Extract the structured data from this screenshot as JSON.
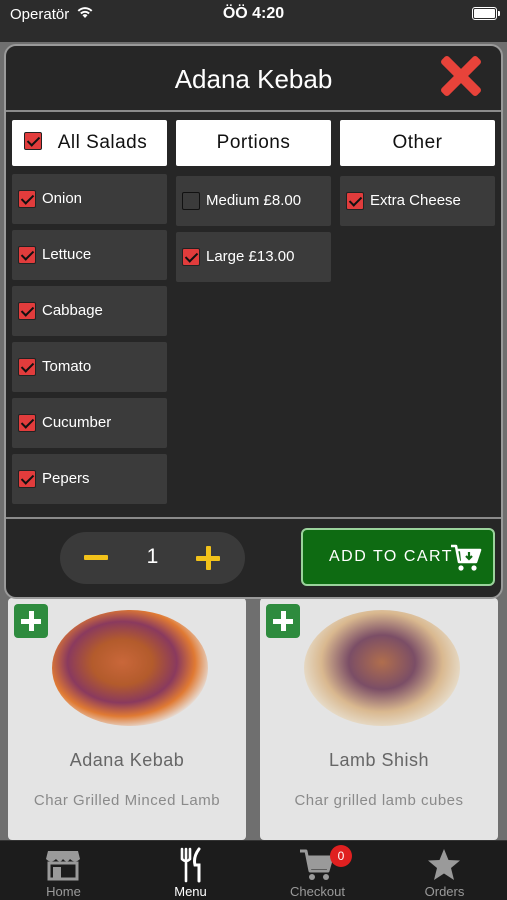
{
  "status_bar": {
    "carrier": "Operatör",
    "time": "ÖÖ 4:20"
  },
  "modal": {
    "title": "Adana Kebab",
    "columns": [
      {
        "header": "All Salads",
        "header_checked": true,
        "options": [
          {
            "label": "Onion",
            "checked": true
          },
          {
            "label": "Lettuce",
            "checked": true
          },
          {
            "label": "Cabbage",
            "checked": true
          },
          {
            "label": "Tomato",
            "checked": true
          },
          {
            "label": "Cucumber",
            "checked": true
          },
          {
            "label": "Pepers",
            "checked": true
          }
        ]
      },
      {
        "header": "Portions",
        "options": [
          {
            "label": "Medium £8.00",
            "checked": false
          },
          {
            "label": "Large £13.00",
            "checked": true
          }
        ]
      },
      {
        "header": "Other",
        "options": [
          {
            "label": "Extra Cheese",
            "checked": true
          }
        ]
      }
    ],
    "quantity": "1",
    "add_to_cart_label": "ADD TO CART"
  },
  "menu_items": [
    {
      "name": "Adana Kebab",
      "description": "Char Grilled Minced Lamb"
    },
    {
      "name": "Lamb Shish",
      "description": "Char grilled lamb cubes"
    }
  ],
  "tab_bar": {
    "tabs": [
      {
        "label": "Home",
        "icon": "store-icon",
        "active": false
      },
      {
        "label": "Menu",
        "icon": "fork-knife-icon",
        "active": true
      },
      {
        "label": "Checkout",
        "icon": "cart-icon",
        "active": false
      },
      {
        "label": "Orders",
        "icon": "star-icon",
        "active": false
      }
    ],
    "cart_badge": "0"
  },
  "colors": {
    "accent_red": "#e13c3c",
    "add_to_cart_green": "#0e6b12",
    "stepper_yellow": "#f2c21a"
  }
}
